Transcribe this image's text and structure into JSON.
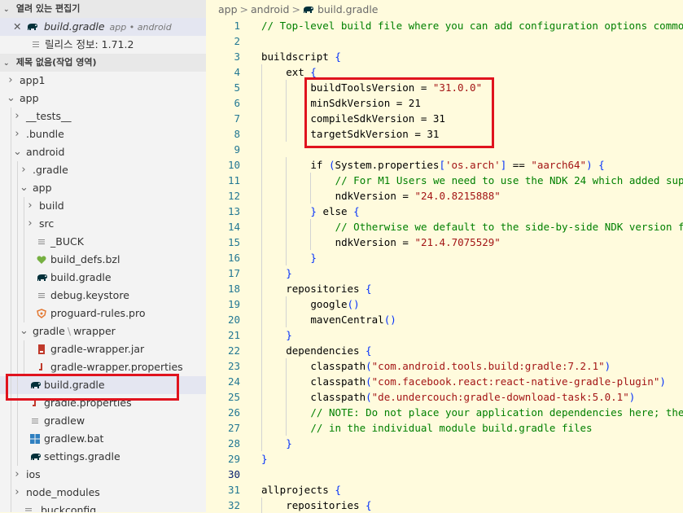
{
  "explorer": {
    "open_editors": {
      "title": "열려 있는 편집기",
      "items": [
        {
          "close": "✕",
          "name": "build.gradle",
          "path": "app • android",
          "icon": "gradle-elephant-icon"
        },
        {
          "name": "릴리스 정보: 1.71.2",
          "icon": "release-notes-icon"
        }
      ]
    },
    "workspace": {
      "title": "제목 없음(작업 영역)",
      "tree": [
        {
          "label": "app1",
          "depth": 0,
          "arrow": "›",
          "icon": ""
        },
        {
          "label": "app",
          "depth": 0,
          "arrow": "⌄",
          "icon": ""
        },
        {
          "label": "__tests__",
          "depth": 1,
          "arrow": "›",
          "icon": ""
        },
        {
          "label": ".bundle",
          "depth": 1,
          "arrow": "›",
          "icon": ""
        },
        {
          "label": "android",
          "depth": 1,
          "arrow": "⌄",
          "icon": ""
        },
        {
          "label": ".gradle",
          "depth": 2,
          "arrow": "›",
          "icon": ""
        },
        {
          "label": "app",
          "depth": 2,
          "arrow": "⌄",
          "icon": ""
        },
        {
          "label": "build",
          "depth": 3,
          "arrow": "›",
          "icon": ""
        },
        {
          "label": "src",
          "depth": 3,
          "arrow": "›",
          "icon": ""
        },
        {
          "label": "_BUCK",
          "depth": 3,
          "arrow": "",
          "icon": "lines-file-icon"
        },
        {
          "label": "build_defs.bzl",
          "depth": 3,
          "arrow": "",
          "icon": "bazel-heart-icon"
        },
        {
          "label": "build.gradle",
          "depth": 3,
          "arrow": "",
          "icon": "gradle-elephant-icon"
        },
        {
          "label": "debug.keystore",
          "depth": 3,
          "arrow": "",
          "icon": "lines-file-icon"
        },
        {
          "label": "proguard-rules.pro",
          "depth": 3,
          "arrow": "",
          "icon": "proguard-shield-icon"
        },
        {
          "label": "gradle",
          "label2": "wrapper",
          "depth": 2,
          "arrow": "⌄",
          "icon": ""
        },
        {
          "label": "gradle-wrapper.jar",
          "depth": 3,
          "arrow": "",
          "icon": "jar-file-icon"
        },
        {
          "label": "gradle-wrapper.properties",
          "depth": 3,
          "arrow": "",
          "icon": "properties-file-icon"
        },
        {
          "label": "build.gradle",
          "depth": 2,
          "arrow": "",
          "icon": "gradle-elephant-icon",
          "selected": true
        },
        {
          "label": "gradle.properties",
          "depth": 2,
          "arrow": "",
          "icon": "properties-file-icon"
        },
        {
          "label": "gradlew",
          "depth": 2,
          "arrow": "",
          "icon": "lines-file-icon"
        },
        {
          "label": "gradlew.bat",
          "depth": 2,
          "arrow": "",
          "icon": "windows-icon"
        },
        {
          "label": "settings.gradle",
          "depth": 2,
          "arrow": "",
          "icon": "gradle-elephant-icon"
        },
        {
          "label": "ios",
          "depth": 1,
          "arrow": "›",
          "icon": ""
        },
        {
          "label": "node_modules",
          "depth": 1,
          "arrow": "›",
          "icon": ""
        },
        {
          "label": ".buckconfig",
          "depth": 1,
          "arrow": "",
          "icon": "lines-file-icon"
        }
      ]
    }
  },
  "breadcrumb": {
    "parts": [
      "app",
      "android"
    ],
    "file": "build.gradle",
    "separator": ">"
  },
  "code": {
    "current_line": 30,
    "lines": [
      {
        "n": "1",
        "i": 0,
        "t": "// Top-level build file where you can add configuration options common",
        "k": "cm"
      },
      {
        "n": "2",
        "i": 0,
        "t": ""
      },
      {
        "n": "3",
        "i": 0,
        "t": "buildscript {"
      },
      {
        "n": "4",
        "i": 1,
        "t": "ext {"
      },
      {
        "n": "5",
        "i": 2,
        "t": "buildToolsVersion = \"31.0.0\""
      },
      {
        "n": "6",
        "i": 2,
        "t": "minSdkVersion = 21"
      },
      {
        "n": "7",
        "i": 2,
        "t": "compileSdkVersion = 31"
      },
      {
        "n": "8",
        "i": 2,
        "t": "targetSdkVersion = 31"
      },
      {
        "n": "9",
        "i": 1,
        "t": ""
      },
      {
        "n": "10",
        "i": 2,
        "t": "if (System.properties['os.arch'] == \"aarch64\") {"
      },
      {
        "n": "11",
        "i": 3,
        "t": "// For M1 Users we need to use the NDK 24 which added sup",
        "k": "cm"
      },
      {
        "n": "12",
        "i": 3,
        "t": "ndkVersion = \"24.0.8215888\""
      },
      {
        "n": "13",
        "i": 2,
        "t": "} else {"
      },
      {
        "n": "14",
        "i": 3,
        "t": "// Otherwise we default to the side-by-side NDK version f",
        "k": "cm"
      },
      {
        "n": "15",
        "i": 3,
        "t": "ndkVersion = \"21.4.7075529\""
      },
      {
        "n": "16",
        "i": 2,
        "t": "}"
      },
      {
        "n": "17",
        "i": 1,
        "t": "}"
      },
      {
        "n": "18",
        "i": 1,
        "t": "repositories {"
      },
      {
        "n": "19",
        "i": 2,
        "t": "google()"
      },
      {
        "n": "20",
        "i": 2,
        "t": "mavenCentral()"
      },
      {
        "n": "21",
        "i": 1,
        "t": "}"
      },
      {
        "n": "22",
        "i": 1,
        "t": "dependencies {"
      },
      {
        "n": "23",
        "i": 2,
        "t": "classpath(\"com.android.tools.build:gradle:7.2.1\")"
      },
      {
        "n": "24",
        "i": 2,
        "t": "classpath(\"com.facebook.react:react-native-gradle-plugin\")"
      },
      {
        "n": "25",
        "i": 2,
        "t": "classpath(\"de.undercouch:gradle-download-task:5.0.1\")"
      },
      {
        "n": "26",
        "i": 2,
        "t": "// NOTE: Do not place your application dependencies here; the",
        "k": "cm"
      },
      {
        "n": "27",
        "i": 2,
        "t": "// in the individual module build.gradle files",
        "k": "cm"
      },
      {
        "n": "28",
        "i": 1,
        "t": "}"
      },
      {
        "n": "29",
        "i": 0,
        "t": "}"
      },
      {
        "n": "30",
        "i": 0,
        "t": ""
      },
      {
        "n": "31",
        "i": 0,
        "t": "allprojects {"
      },
      {
        "n": "32",
        "i": 1,
        "t": "repositories {"
      }
    ]
  },
  "colors": {
    "highlight_box": "#e0131e",
    "editor_bg": "#fffbdd",
    "gradle_icon": "#02303a"
  }
}
